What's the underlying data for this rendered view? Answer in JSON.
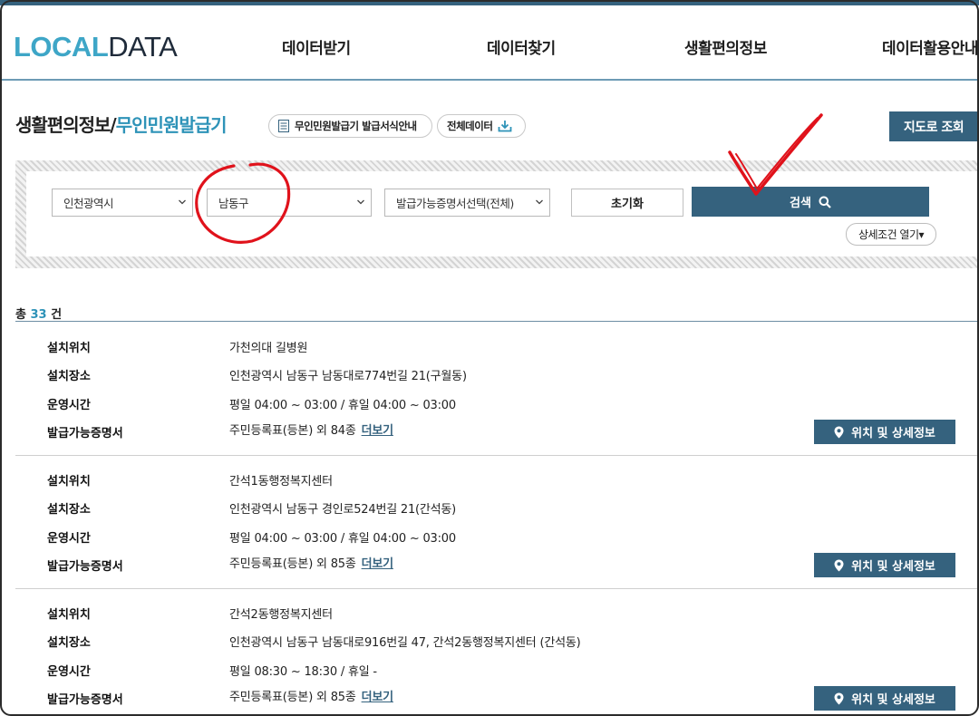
{
  "header": {
    "logo_part1": "LOCAL",
    "logo_part2": "DATA",
    "nav": [
      "데이터받기",
      "데이터찾기",
      "생활편의정보",
      "데이터활용안내"
    ]
  },
  "title": {
    "main": "생활편의정보",
    "separator": "/",
    "sub": "무인민원발급기",
    "guide_pill": "무인민원발급기 발급서식안내",
    "all_data_pill": "전체데이터",
    "map_button": "지도로 조회"
  },
  "search": {
    "city": "인천광역시",
    "district": "남동구",
    "document": "발급가능증명서선택(전체)",
    "reset_label": "초기화",
    "search_label": "검색",
    "detail_toggle": "상세조건 열기▾"
  },
  "results": {
    "total_prefix": "총",
    "total_count": "33",
    "total_suffix": "건",
    "labels": {
      "location": "설치위치",
      "place": "설치장소",
      "hours": "운영시간",
      "documents": "발급가능증명서"
    },
    "more_label": "더보기",
    "detail_button": "위치 및 상세정보",
    "records": [
      {
        "location": "가천의대 길병원",
        "place": "인천광역시 남동구 남동대로774번길 21(구월동)",
        "hours": "평일 04:00 ~ 03:00 / 휴일 04:00 ~ 03:00",
        "documents": "주민등록표(등본) 외 84종"
      },
      {
        "location": "간석1동행정복지센터",
        "place": "인천광역시 남동구 경인로524번길 21(간석동)",
        "hours": "평일 04:00 ~ 03:00 / 휴일 04:00 ~ 03:00",
        "documents": "주민등록표(등본) 외 85종"
      },
      {
        "location": "간석2동행정복지센터",
        "place": "인천광역시 남동구 남동대로916번길 47, 간석2동행정복지센터 (간석동)",
        "hours": "평일 08:30 ~ 18:30 / 휴일 -",
        "documents": "주민등록표(등본) 외 85종"
      }
    ]
  },
  "colors": {
    "brand": "#35627e",
    "accent": "#2e93b8",
    "annotation": "#e0121b"
  }
}
